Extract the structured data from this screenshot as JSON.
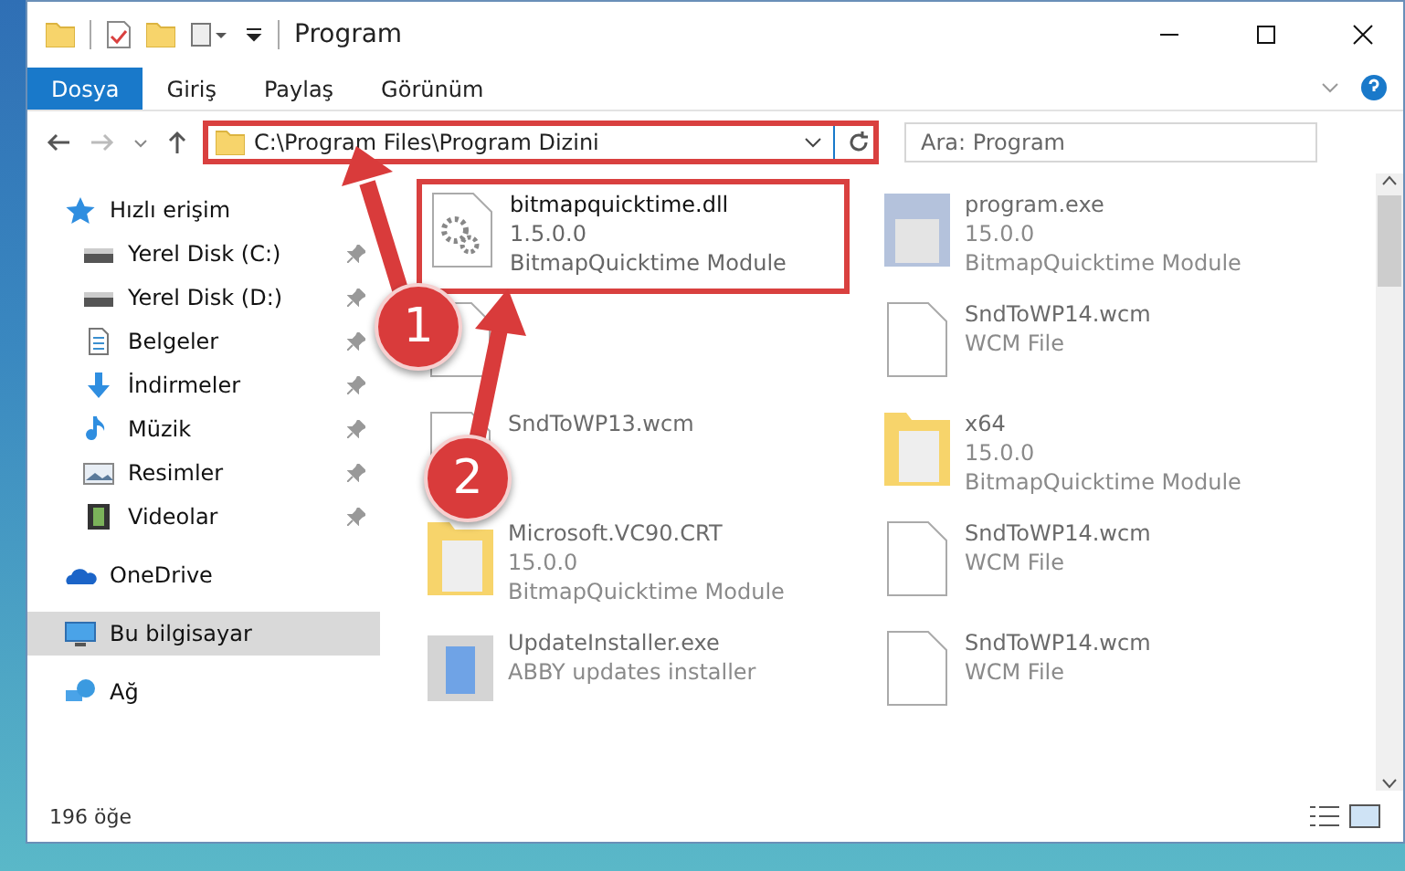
{
  "window": {
    "title": "Program"
  },
  "ribbon_tabs": [
    {
      "label": "Dosya",
      "selected": true
    },
    {
      "label": "Giriş",
      "selected": false
    },
    {
      "label": "Paylaş",
      "selected": false
    },
    {
      "label": "Görünüm",
      "selected": false
    }
  ],
  "address": {
    "value": "C:\\Program Files\\Program Dizini"
  },
  "search": {
    "placeholder": "Ara: Program"
  },
  "sidebar": {
    "items": [
      {
        "label": "Hızlı erişim",
        "kind": "star",
        "pinned": false,
        "selected": false,
        "children": [
          {
            "label": "Yerel Disk (C:)",
            "kind": "drive",
            "pinned": true,
            "selected": false
          },
          {
            "label": "Yerel Disk (D:)",
            "kind": "drive",
            "pinned": true,
            "selected": false
          },
          {
            "label": "Belgeler",
            "kind": "doc",
            "pinned": true,
            "selected": false
          },
          {
            "label": "İndirmeler",
            "kind": "download",
            "pinned": true,
            "selected": false
          },
          {
            "label": "Müzik",
            "kind": "music",
            "pinned": true,
            "selected": false
          },
          {
            "label": "Resimler",
            "kind": "picture",
            "pinned": true,
            "selected": false
          },
          {
            "label": "Videolar",
            "kind": "video",
            "pinned": true,
            "selected": false
          }
        ]
      },
      {
        "label": "OneDrive",
        "kind": "cloud",
        "pinned": false,
        "selected": false
      },
      {
        "label": "Bu bilgisayar",
        "kind": "computer",
        "pinned": false,
        "selected": true
      },
      {
        "label": "Ağ",
        "kind": "network",
        "pinned": false,
        "selected": false
      }
    ]
  },
  "files": [
    {
      "kind": "dll",
      "lines": [
        "bitmapquicktime.dll",
        "1.5.0.0",
        "BitmapQuicktime Module"
      ],
      "blurred": false
    },
    {
      "kind": "exe",
      "lines": [
        "program.exe",
        "15.0.0",
        "BitmapQuicktime Module"
      ],
      "blurred": true
    },
    {
      "kind": "blank",
      "blurred": true
    },
    {
      "kind": "blank",
      "lines": [
        "SndToWP14.wcm",
        "WCM File"
      ],
      "blurred": true
    },
    {
      "kind": "blank",
      "lines": [
        "SndToWP13.wcm"
      ],
      "blurred": true
    },
    {
      "kind": "folder",
      "lines": [
        "x64",
        "15.0.0",
        "BitmapQuicktime Module"
      ],
      "blurred": true
    },
    {
      "kind": "folder",
      "lines": [
        "Microsoft.VC90.CRT",
        "15.0.0",
        "BitmapQuicktime Module"
      ],
      "blurred": true
    },
    {
      "kind": "blank",
      "lines": [
        "SndToWP14.wcm",
        "WCM File"
      ],
      "blurred": true
    },
    {
      "kind": "installer",
      "lines": [
        "UpdateInstaller.exe",
        "ABBY updates installer"
      ],
      "blurred": true
    },
    {
      "kind": "blank",
      "lines": [
        "SndToWP14.wcm",
        "WCM File"
      ],
      "blurred": true
    }
  ],
  "status_bar": {
    "count": "196 öğe"
  },
  "markers": [
    {
      "label": "1"
    },
    {
      "label": "2"
    }
  ]
}
